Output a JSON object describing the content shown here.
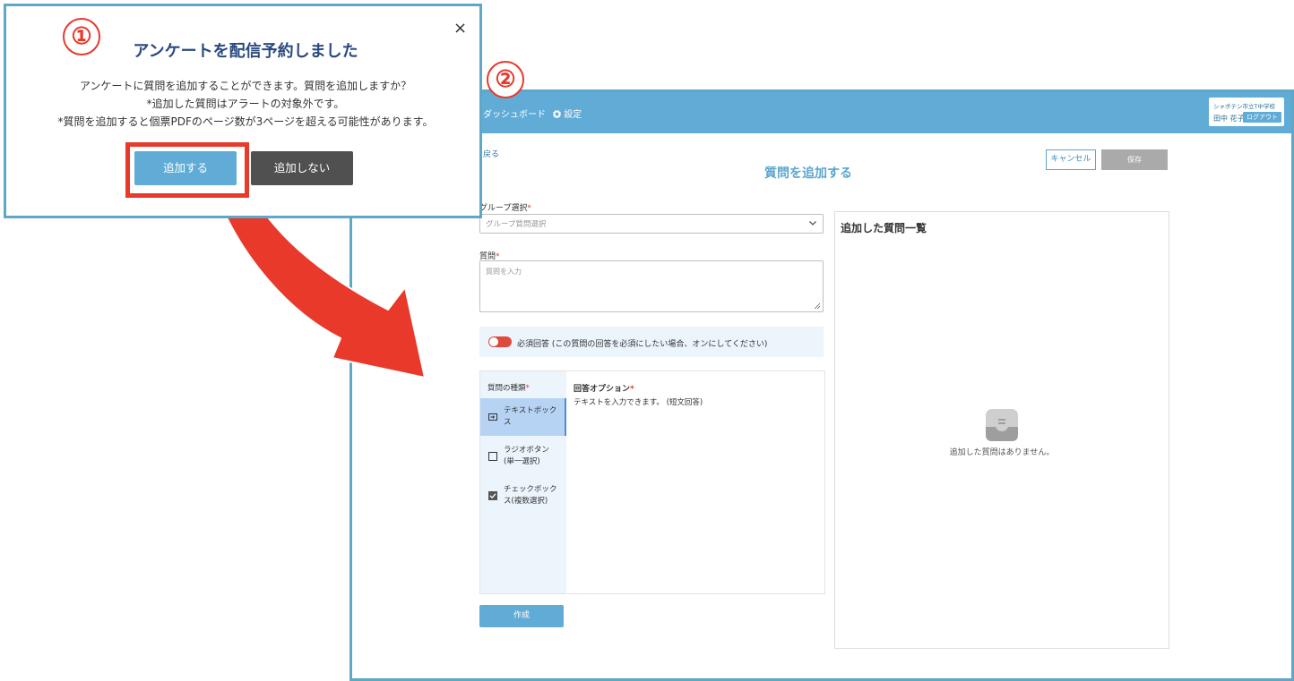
{
  "steps": [
    "①",
    "②"
  ],
  "dialog": {
    "title": "アンケートを配信予約しました",
    "close": "×",
    "messages": [
      "アンケートに質問を追加することができます。質問を追加しますか？",
      "*追加した質問はアラートの対象外です。",
      "*質問を追加すると個票PDFのページ数が3ページを超える可能性があります。"
    ],
    "add_label": "追加する",
    "no_add_label": "追加しない"
  },
  "nav": {
    "dashboard": "ダッシュボード",
    "settings": "設定",
    "school": "シャボテン市立T中学校",
    "user": "田中 花子",
    "logout": "ログアウト"
  },
  "page": {
    "back": "戻る",
    "title": "質問を追加する",
    "cancel": "キャンセル",
    "save": "保存"
  },
  "form": {
    "group_label": "グループ選択",
    "group_placeholder": "グループ質問選択",
    "question_label": "質問",
    "question_placeholder": "質問を入力",
    "required_text": "必須回答 (この質問の回答を必須にしたい場合、オンにしてください)",
    "type_label": "質問の種類",
    "types": [
      {
        "label": "テキストボックス",
        "icon": "textbox-icon"
      },
      {
        "label": "ラジオボタン(単一選択)",
        "icon": "radio-icon"
      },
      {
        "label": "チェックボックス(複数選択)",
        "icon": "checkbox-icon"
      }
    ],
    "option_label": "回答オプション",
    "option_text": "テキストを入力できます。 (短文回答)",
    "create": "作成",
    "required_mark": "*"
  },
  "question_list": {
    "title": "追加した質問一覧",
    "empty": "追加した質問はありません。"
  },
  "colors": {
    "accent": "#60acd6",
    "annotation": "#e8392b",
    "frame": "#5fa7c8"
  }
}
